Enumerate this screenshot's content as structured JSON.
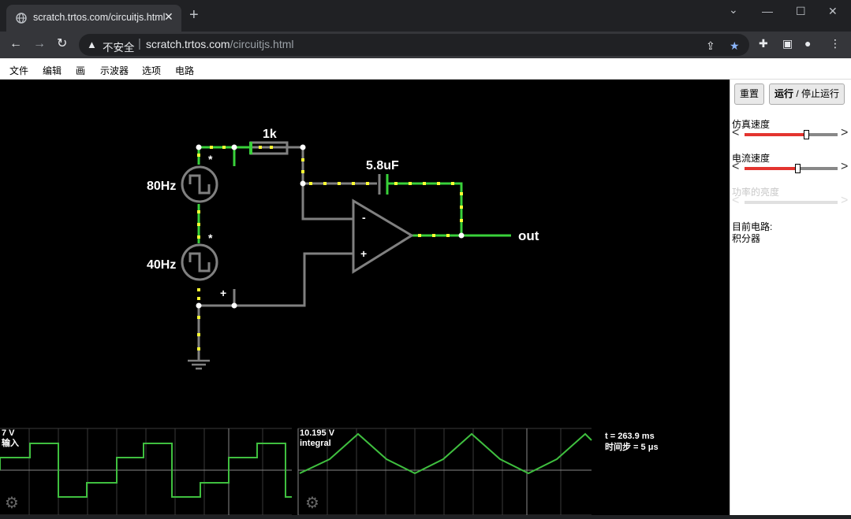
{
  "browser": {
    "tab_title": "scratch.trtos.com/circuitjs.html",
    "insecure_label": "不安全",
    "url_host": "scratch.trtos.com",
    "url_path": "/circuitjs.html"
  },
  "menu": [
    "文件",
    "编辑",
    "画",
    "示波器",
    "选项",
    "电路"
  ],
  "side": {
    "reset_label": "重置",
    "run_label": "运行",
    "run_sep": " / ",
    "stop_label": "停止运行",
    "sim_speed_label": "仿真速度",
    "sim_speed_value": 0.66,
    "current_speed_label": "电流速度",
    "current_speed_value": 0.57,
    "power_label": "功率的亮度",
    "current_circuit_label": "目前电路:",
    "current_circuit_name": "积分器"
  },
  "circuit": {
    "resistor_label": "1k",
    "capacitor_label": "5.8uF",
    "source1_label": "80Hz",
    "source2_label": "40Hz",
    "output_label": "out",
    "source1_marker": "*",
    "source2_marker": "*",
    "ground_marker": "+",
    "opamp_minus": "-",
    "opamp_plus": "+"
  },
  "scopes": {
    "scope1_value": "7 V",
    "scope1_name": "输入",
    "scope2_value": "10.195 V",
    "scope2_name": "integral",
    "time_label": "t = 263.9 ms",
    "timestep_label": "时间步 = 5 μs"
  },
  "colors": {
    "wire_gray": "#808080",
    "wire_green": "#39d13a",
    "current_dot": "#ffff33",
    "scope_trace": "#3fbf3f",
    "slider_fill": "#e3342f"
  }
}
